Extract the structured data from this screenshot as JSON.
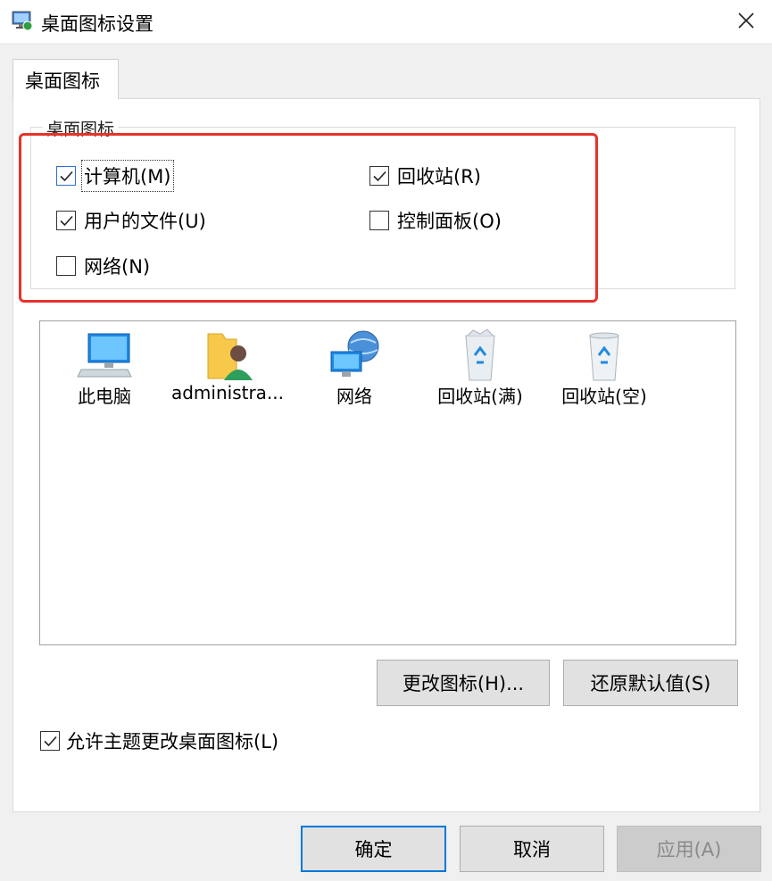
{
  "window": {
    "title": "桌面图标设置",
    "close_icon": "close-icon",
    "app_icon": "display-settings-icon"
  },
  "tabs": [
    {
      "label": "桌面图标",
      "selected": true
    }
  ],
  "desktop_icons_group": {
    "title": "桌面图标",
    "checkboxes": [
      {
        "label": "计算机(M)",
        "checked": true
      },
      {
        "label": "回收站(R)",
        "checked": true
      },
      {
        "label": "用户的文件(U)",
        "checked": true
      },
      {
        "label": "控制面板(O)",
        "checked": false
      },
      {
        "label": "网络(N)",
        "checked": false
      }
    ]
  },
  "icon_list": {
    "items": [
      {
        "label": "此电脑",
        "icon": "computer-icon"
      },
      {
        "label": "administra...",
        "icon": "user-folder-icon"
      },
      {
        "label": "网络",
        "icon": "network-icon"
      },
      {
        "label": "回收站(满)",
        "icon": "recycle-bin-full-icon"
      },
      {
        "label": "回收站(空)",
        "icon": "recycle-bin-empty-icon"
      }
    ]
  },
  "buttons": {
    "change_icon": "更改图标(H)...",
    "restore_default": "还原默认值(S)",
    "ok": "确定",
    "cancel": "取消",
    "apply": "应用(A)"
  },
  "allow_theme": {
    "label": "允许主题更改桌面图标(L)",
    "checked": true
  },
  "colors": {
    "highlight_border": "#e8322b",
    "accent": "#0078d7"
  }
}
